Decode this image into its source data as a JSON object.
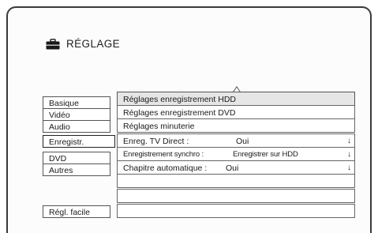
{
  "header": {
    "title": "RÉGLAGE",
    "icon": "toolbox-icon"
  },
  "left_menu": {
    "items": [
      {
        "label": "Basique"
      },
      {
        "label": "Vidéo"
      },
      {
        "label": "Audio"
      },
      {
        "label": "Enregistr."
      },
      {
        "label": "DVD"
      },
      {
        "label": "Autres"
      },
      {
        "label": "Régl. facile"
      }
    ],
    "selected": "Enregistr."
  },
  "right_panel": {
    "rows": [
      {
        "label": "Réglages enregistrement HDD"
      },
      {
        "label": "Réglages enregistrement DVD"
      },
      {
        "label": "Réglages minuterie"
      },
      {
        "label": "Enreg. TV Direct :",
        "value": "Oui",
        "arrow": "↓"
      },
      {
        "label": "Enregistrement synchro :",
        "value": "Enregistrer sur HDD",
        "arrow": "↓"
      },
      {
        "label": "Chapitre automatique :",
        "value": "Oui",
        "arrow": "↓"
      }
    ]
  }
}
